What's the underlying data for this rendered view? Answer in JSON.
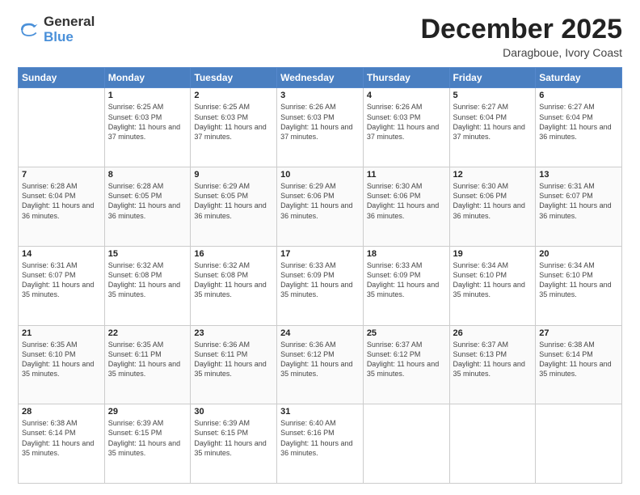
{
  "header": {
    "logo_general": "General",
    "logo_blue": "Blue",
    "month_title": "December 2025",
    "location": "Daragboue, Ivory Coast"
  },
  "days_of_week": [
    "Sunday",
    "Monday",
    "Tuesday",
    "Wednesday",
    "Thursday",
    "Friday",
    "Saturday"
  ],
  "weeks": [
    [
      {
        "num": "",
        "empty": true
      },
      {
        "num": "1",
        "sunrise": "6:25 AM",
        "sunset": "6:03 PM",
        "daylight": "11 hours and 37 minutes."
      },
      {
        "num": "2",
        "sunrise": "6:25 AM",
        "sunset": "6:03 PM",
        "daylight": "11 hours and 37 minutes."
      },
      {
        "num": "3",
        "sunrise": "6:26 AM",
        "sunset": "6:03 PM",
        "daylight": "11 hours and 37 minutes."
      },
      {
        "num": "4",
        "sunrise": "6:26 AM",
        "sunset": "6:03 PM",
        "daylight": "11 hours and 37 minutes."
      },
      {
        "num": "5",
        "sunrise": "6:27 AM",
        "sunset": "6:04 PM",
        "daylight": "11 hours and 37 minutes."
      },
      {
        "num": "6",
        "sunrise": "6:27 AM",
        "sunset": "6:04 PM",
        "daylight": "11 hours and 36 minutes."
      }
    ],
    [
      {
        "num": "7",
        "sunrise": "6:28 AM",
        "sunset": "6:04 PM",
        "daylight": "11 hours and 36 minutes."
      },
      {
        "num": "8",
        "sunrise": "6:28 AM",
        "sunset": "6:05 PM",
        "daylight": "11 hours and 36 minutes."
      },
      {
        "num": "9",
        "sunrise": "6:29 AM",
        "sunset": "6:05 PM",
        "daylight": "11 hours and 36 minutes."
      },
      {
        "num": "10",
        "sunrise": "6:29 AM",
        "sunset": "6:06 PM",
        "daylight": "11 hours and 36 minutes."
      },
      {
        "num": "11",
        "sunrise": "6:30 AM",
        "sunset": "6:06 PM",
        "daylight": "11 hours and 36 minutes."
      },
      {
        "num": "12",
        "sunrise": "6:30 AM",
        "sunset": "6:06 PM",
        "daylight": "11 hours and 36 minutes."
      },
      {
        "num": "13",
        "sunrise": "6:31 AM",
        "sunset": "6:07 PM",
        "daylight": "11 hours and 36 minutes."
      }
    ],
    [
      {
        "num": "14",
        "sunrise": "6:31 AM",
        "sunset": "6:07 PM",
        "daylight": "11 hours and 35 minutes."
      },
      {
        "num": "15",
        "sunrise": "6:32 AM",
        "sunset": "6:08 PM",
        "daylight": "11 hours and 35 minutes."
      },
      {
        "num": "16",
        "sunrise": "6:32 AM",
        "sunset": "6:08 PM",
        "daylight": "11 hours and 35 minutes."
      },
      {
        "num": "17",
        "sunrise": "6:33 AM",
        "sunset": "6:09 PM",
        "daylight": "11 hours and 35 minutes."
      },
      {
        "num": "18",
        "sunrise": "6:33 AM",
        "sunset": "6:09 PM",
        "daylight": "11 hours and 35 minutes."
      },
      {
        "num": "19",
        "sunrise": "6:34 AM",
        "sunset": "6:10 PM",
        "daylight": "11 hours and 35 minutes."
      },
      {
        "num": "20",
        "sunrise": "6:34 AM",
        "sunset": "6:10 PM",
        "daylight": "11 hours and 35 minutes."
      }
    ],
    [
      {
        "num": "21",
        "sunrise": "6:35 AM",
        "sunset": "6:10 PM",
        "daylight": "11 hours and 35 minutes."
      },
      {
        "num": "22",
        "sunrise": "6:35 AM",
        "sunset": "6:11 PM",
        "daylight": "11 hours and 35 minutes."
      },
      {
        "num": "23",
        "sunrise": "6:36 AM",
        "sunset": "6:11 PM",
        "daylight": "11 hours and 35 minutes."
      },
      {
        "num": "24",
        "sunrise": "6:36 AM",
        "sunset": "6:12 PM",
        "daylight": "11 hours and 35 minutes."
      },
      {
        "num": "25",
        "sunrise": "6:37 AM",
        "sunset": "6:12 PM",
        "daylight": "11 hours and 35 minutes."
      },
      {
        "num": "26",
        "sunrise": "6:37 AM",
        "sunset": "6:13 PM",
        "daylight": "11 hours and 35 minutes."
      },
      {
        "num": "27",
        "sunrise": "6:38 AM",
        "sunset": "6:14 PM",
        "daylight": "11 hours and 35 minutes."
      }
    ],
    [
      {
        "num": "28",
        "sunrise": "6:38 AM",
        "sunset": "6:14 PM",
        "daylight": "11 hours and 35 minutes."
      },
      {
        "num": "29",
        "sunrise": "6:39 AM",
        "sunset": "6:15 PM",
        "daylight": "11 hours and 35 minutes."
      },
      {
        "num": "30",
        "sunrise": "6:39 AM",
        "sunset": "6:15 PM",
        "daylight": "11 hours and 35 minutes."
      },
      {
        "num": "31",
        "sunrise": "6:40 AM",
        "sunset": "6:16 PM",
        "daylight": "11 hours and 36 minutes."
      },
      {
        "num": "",
        "empty": true
      },
      {
        "num": "",
        "empty": true
      },
      {
        "num": "",
        "empty": true
      }
    ]
  ]
}
